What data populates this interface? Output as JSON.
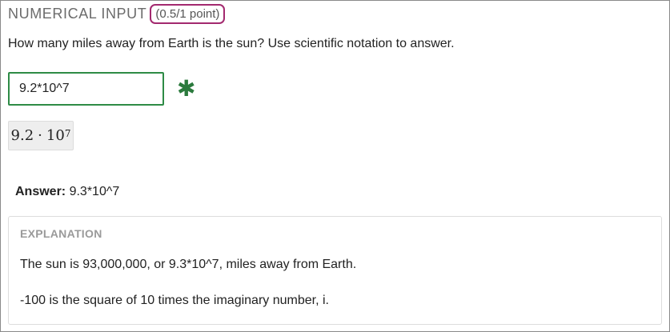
{
  "header": {
    "problem_type": "NUMERICAL INPUT",
    "points": "(0.5/1 point)"
  },
  "question": {
    "text": "How many miles away from Earth is the sun? Use scientific notation to answer."
  },
  "input": {
    "value": "9.2*10^7",
    "status_icon": "asterisk-icon",
    "status_color": "#2b7a3d",
    "border_color": "#2e8b46"
  },
  "preview": {
    "mantissa": "9.2",
    "operator": "·",
    "base": "10",
    "exponent": "7"
  },
  "answer": {
    "label": "Answer:",
    "value": "9.3*10^7"
  },
  "explanation": {
    "title": "EXPLANATION",
    "paragraphs": [
      "The sun is 93,000,000, or 9.3*10^7, miles away from Earth.",
      "-100 is the square of 10 times the imaginary number, i."
    ]
  },
  "colors": {
    "badge_border": "#a3296f"
  }
}
